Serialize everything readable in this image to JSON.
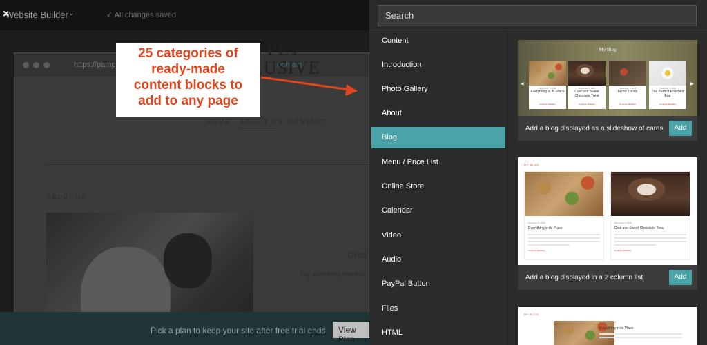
{
  "topbar": {
    "close": "×",
    "title": "Website Builder",
    "chevron": "⌄",
    "saved": "✓   All changes saved"
  },
  "preview": {
    "url": "https://pamp",
    "url_suffix": "domain",
    "logo_line1": "RED PET",
    "logo_line2": "EXCLUSIVE",
    "nav": [
      "HOME",
      "ABOUT US",
      "CONTACT"
    ],
    "about_heading": "ABOUT US",
    "grab": "Grab",
    "say": "Say something interesti",
    "plan_text": "Pick a plan to keep your site after free trial ends",
    "plan_button": "View Plan"
  },
  "callout": {
    "line1": "25 categories of",
    "line2": "ready-made",
    "line3": "content blocks to",
    "line4": "add to any page"
  },
  "panel": {
    "search_placeholder": "Search",
    "categories": [
      "Content",
      "Introduction",
      "Photo Gallery",
      "About",
      "Blog",
      "Menu / Price List",
      "Online Store",
      "Calendar",
      "Video",
      "Audio",
      "PayPal Button",
      "Files",
      "HTML"
    ],
    "active_index": 4,
    "cards": [
      {
        "label": "Add a blog displayed as a slideshow of cards",
        "button": "Add",
        "preview_title": "My Blog",
        "posts": [
          {
            "date": "November 5, 2015",
            "title": "Everything in its Place",
            "link": "Continue Reading"
          },
          {
            "date": "November 5, 2015",
            "title": "Cold and Sweet Chocolate Treat",
            "link": "Continue Reading"
          },
          {
            "date": "November 5, 2015",
            "title": "Picnic Lunch",
            "link": "Continue Reading"
          },
          {
            "date": "November 5, 2015",
            "title": "The Perfect Poached Egg",
            "link": "Continue Reading"
          }
        ]
      },
      {
        "label": "Add a blog displayed in a 2 column list",
        "button": "Add",
        "preview_title": "MY BLOG",
        "posts": [
          {
            "date": "November 5, 2015",
            "title": "Everything in its Place",
            "link": "Continue Reading"
          },
          {
            "date": "November 5, 2015",
            "title": "Cold and Sweet Chocolate Treat",
            "link": "Continue Reading"
          }
        ]
      },
      {
        "preview_title": "MY BLOG",
        "posts": [
          {
            "date": "November 5, 2015",
            "title": "Everything in its Place"
          }
        ]
      }
    ]
  },
  "colors": {
    "accent": "#49a3a7",
    "callout_text": "#e2461f",
    "panel_bg": "#2b2b2b"
  }
}
